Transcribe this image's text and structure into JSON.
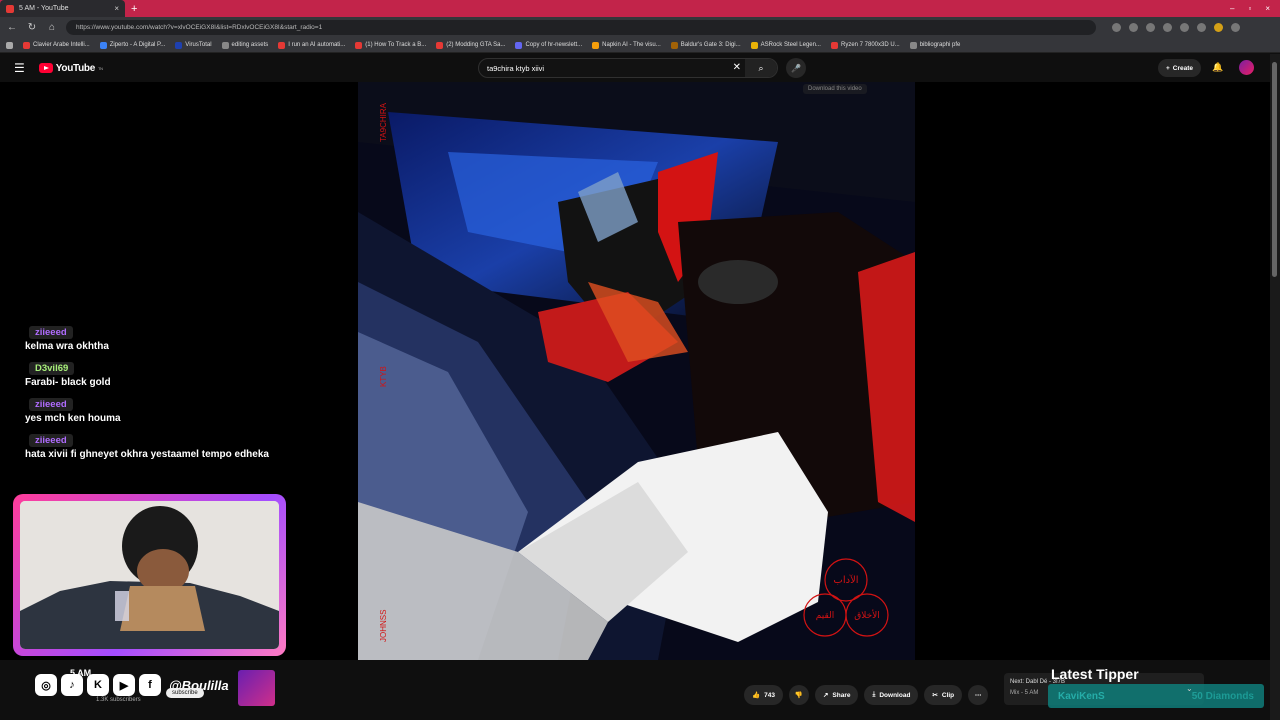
{
  "browser": {
    "tab_title": "5 AM - YouTube",
    "tab_close": "×",
    "new_tab": "+",
    "window_controls": [
      "–",
      "▫",
      "×"
    ],
    "url": "https://www.youtube.com/watch?v=xlvOCEiGX8I&list=RDxlvOCEiGX8I&start_radio=1",
    "bookmarks": [
      {
        "label": "Clavier Arabe Intelli...",
        "color": "#e53935"
      },
      {
        "label": "Ziperto - A Digital P...",
        "color": "#3b82f6"
      },
      {
        "label": "VirusTotal",
        "color": "#1e40af"
      },
      {
        "label": "editing assets",
        "color": "#888888"
      },
      {
        "label": "I run an AI automati...",
        "color": "#e53935"
      },
      {
        "label": "(1) How To Track a B...",
        "color": "#e53935"
      },
      {
        "label": "(2) Modding GTA Sa...",
        "color": "#e53935"
      },
      {
        "label": "Copy of hr-newslett...",
        "color": "#6366f1"
      },
      {
        "label": "Napkin AI - The visu...",
        "color": "#f59e0b"
      },
      {
        "label": "Baldur's Gate 3: Digi...",
        "color": "#a16207"
      },
      {
        "label": "ASRock Steel Legen...",
        "color": "#eab308"
      },
      {
        "label": "Ryzen 7 7800x3D U...",
        "color": "#e53935"
      },
      {
        "label": "bibliographi pfe",
        "color": "#888888"
      }
    ]
  },
  "header": {
    "menu_icon": "☰",
    "logo_text": "YouTube",
    "logo_sup": "TN",
    "search_value": "ta9chira ktyb xiivi",
    "clear_icon": "✕",
    "search_icon": "⌕",
    "mic_icon": "🎤",
    "create_label": "Create",
    "create_icon": "+",
    "bell_icon": "🔔"
  },
  "video": {
    "download_tooltip": "Download this video",
    "cover_text_top": "TA9CHIRA",
    "cover_text_mid": "KTYB",
    "cover_text_bottom": "JOHNSS",
    "arabic_1": "الآداب",
    "arabic_2": "الأخلاق",
    "arabic_3": "القيم"
  },
  "chat": [
    {
      "user": "ziieeed",
      "user_color": "#b06cff",
      "text": "kelma wra okhtha"
    },
    {
      "user": "D3vil69",
      "user_color": "#a8f07a",
      "text": "Farabi- black gold"
    },
    {
      "user": "ziieeed",
      "user_color": "#b06cff",
      "text": "yes mch ken houma"
    },
    {
      "user": "ziieeed",
      "user_color": "#b06cff",
      "text": "hata xivii fi ghneyet okhra yestaamel tempo edheka"
    }
  ],
  "overlay": {
    "channel_name": "5 AM",
    "handle": "@Boulilla",
    "subscribe_label": "subscribe",
    "sub_count": "1.3K subscribers",
    "social_icons": [
      "◎",
      "♪",
      "K",
      "▶",
      "f"
    ]
  },
  "actions": {
    "like_count": "743",
    "like_icon": "👍",
    "dislike_icon": "👎",
    "share_label": "Share",
    "share_icon": "↗",
    "download_label": "Download",
    "download_icon": "⤓",
    "clip_label": "Clip",
    "clip_icon": "✂",
    "more_icon": "⋯"
  },
  "next": {
    "label": "Next: Dabl Dé - 3I7B",
    "sub": "Mix - 5 AM"
  },
  "tipper": {
    "title": "Latest Tipper",
    "name": "KaviKenS",
    "amount": "50 Diamonds",
    "chevron": "⌄"
  }
}
